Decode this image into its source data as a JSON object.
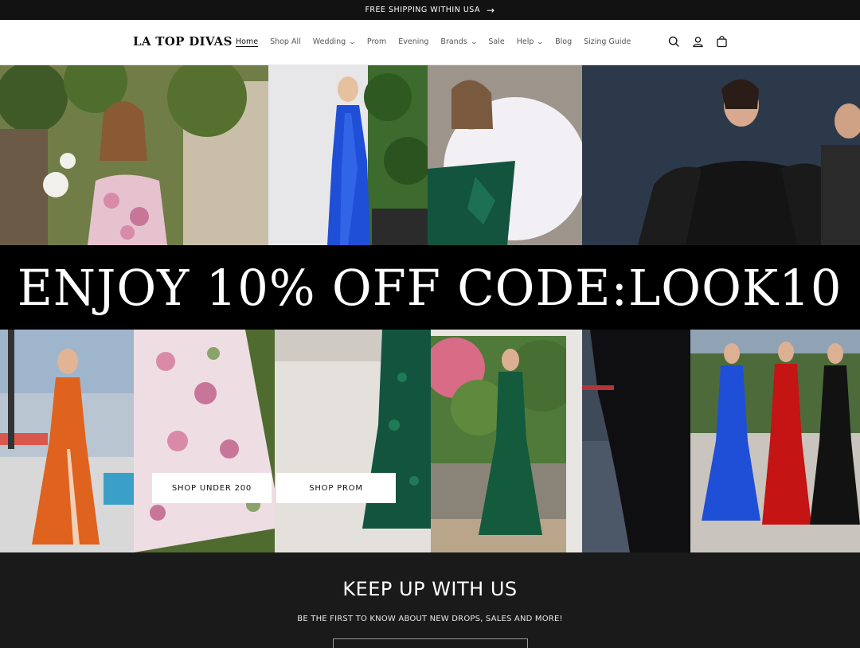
{
  "announcement": {
    "text": "FREE SHIPPING WITHIN USA",
    "arrow": "→"
  },
  "header": {
    "logo": "LA TOP DIVAS",
    "nav": [
      {
        "label": "Home",
        "active": true,
        "dropdown": false
      },
      {
        "label": "Shop All",
        "active": false,
        "dropdown": false
      },
      {
        "label": "Wedding",
        "active": false,
        "dropdown": true
      },
      {
        "label": "Prom",
        "active": false,
        "dropdown": false
      },
      {
        "label": "Evening",
        "active": false,
        "dropdown": false
      },
      {
        "label": "Brands",
        "active": false,
        "dropdown": true
      },
      {
        "label": "Sale",
        "active": false,
        "dropdown": false
      },
      {
        "label": "Help",
        "active": false,
        "dropdown": true
      },
      {
        "label": "Blog",
        "active": false,
        "dropdown": false
      },
      {
        "label": "Sizing Guide",
        "active": false,
        "dropdown": false
      }
    ],
    "icons": [
      "search-icon",
      "account-icon",
      "cart-icon"
    ]
  },
  "hero": {
    "promo": "ENJOY 10% OFF CODE:LOOK10",
    "buttons": {
      "under200": "SHOP UNDER 200",
      "prom": "SHOP PROM"
    }
  },
  "newsletter": {
    "title": "KEEP UP WITH US",
    "subtitle": "BE THE FIRST TO KNOW ABOUT NEW DROPS, SALES AND MORE!",
    "placeholder": ""
  },
  "colors": {
    "announcement_bg": "#121212",
    "footer_bg": "#1a1a1a",
    "promo_bg": "#000000",
    "dress_blue": "#1e4fd6",
    "dress_green": "#13543f",
    "dress_orange": "#e0621f",
    "dress_red": "#c41414"
  }
}
